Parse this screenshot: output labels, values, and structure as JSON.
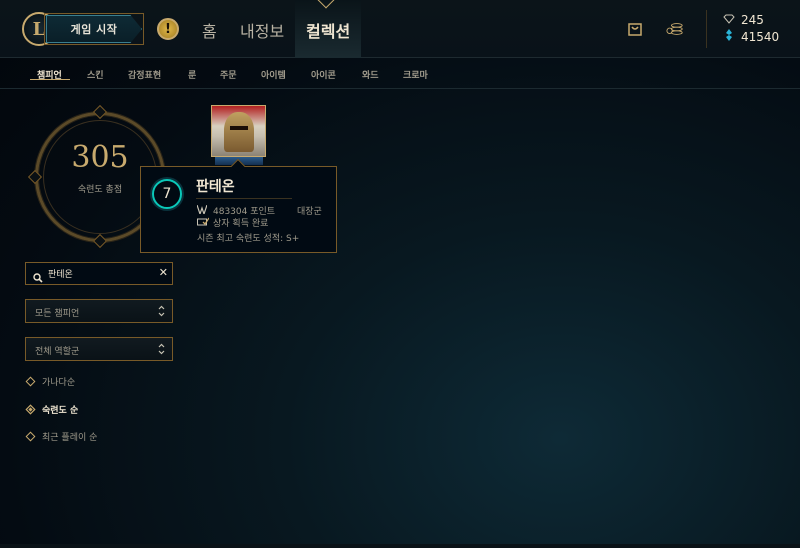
{
  "header": {
    "logo_letter": "L",
    "play_button": "게임 시작",
    "alert_icon": "!",
    "nav": [
      "홈",
      "내정보",
      "컬렉션"
    ],
    "currency": {
      "rp": "245",
      "be": "41540"
    }
  },
  "subnav": {
    "items": [
      "챔피언",
      "스킨",
      "감정표현",
      "룬",
      "주문",
      "아이템",
      "아이콘",
      "와드",
      "크로마"
    ]
  },
  "mastery": {
    "total": "305",
    "label": "숙련도 총점"
  },
  "tooltip": {
    "level": "7",
    "name": "판테온",
    "points": "483304 포인트",
    "rank": "대장군",
    "chest": "상자 획득 완료",
    "season_best": "시즌 최고 숙련도 성적: S+"
  },
  "filters": {
    "search_value": "판테온",
    "clear_icon": "✕",
    "champion_filter": "모든 챔피언",
    "role_filter": "전체 역할군"
  },
  "sort": {
    "options": [
      "가나다순",
      "숙련도 순",
      "최근 플레이 순"
    ]
  }
}
